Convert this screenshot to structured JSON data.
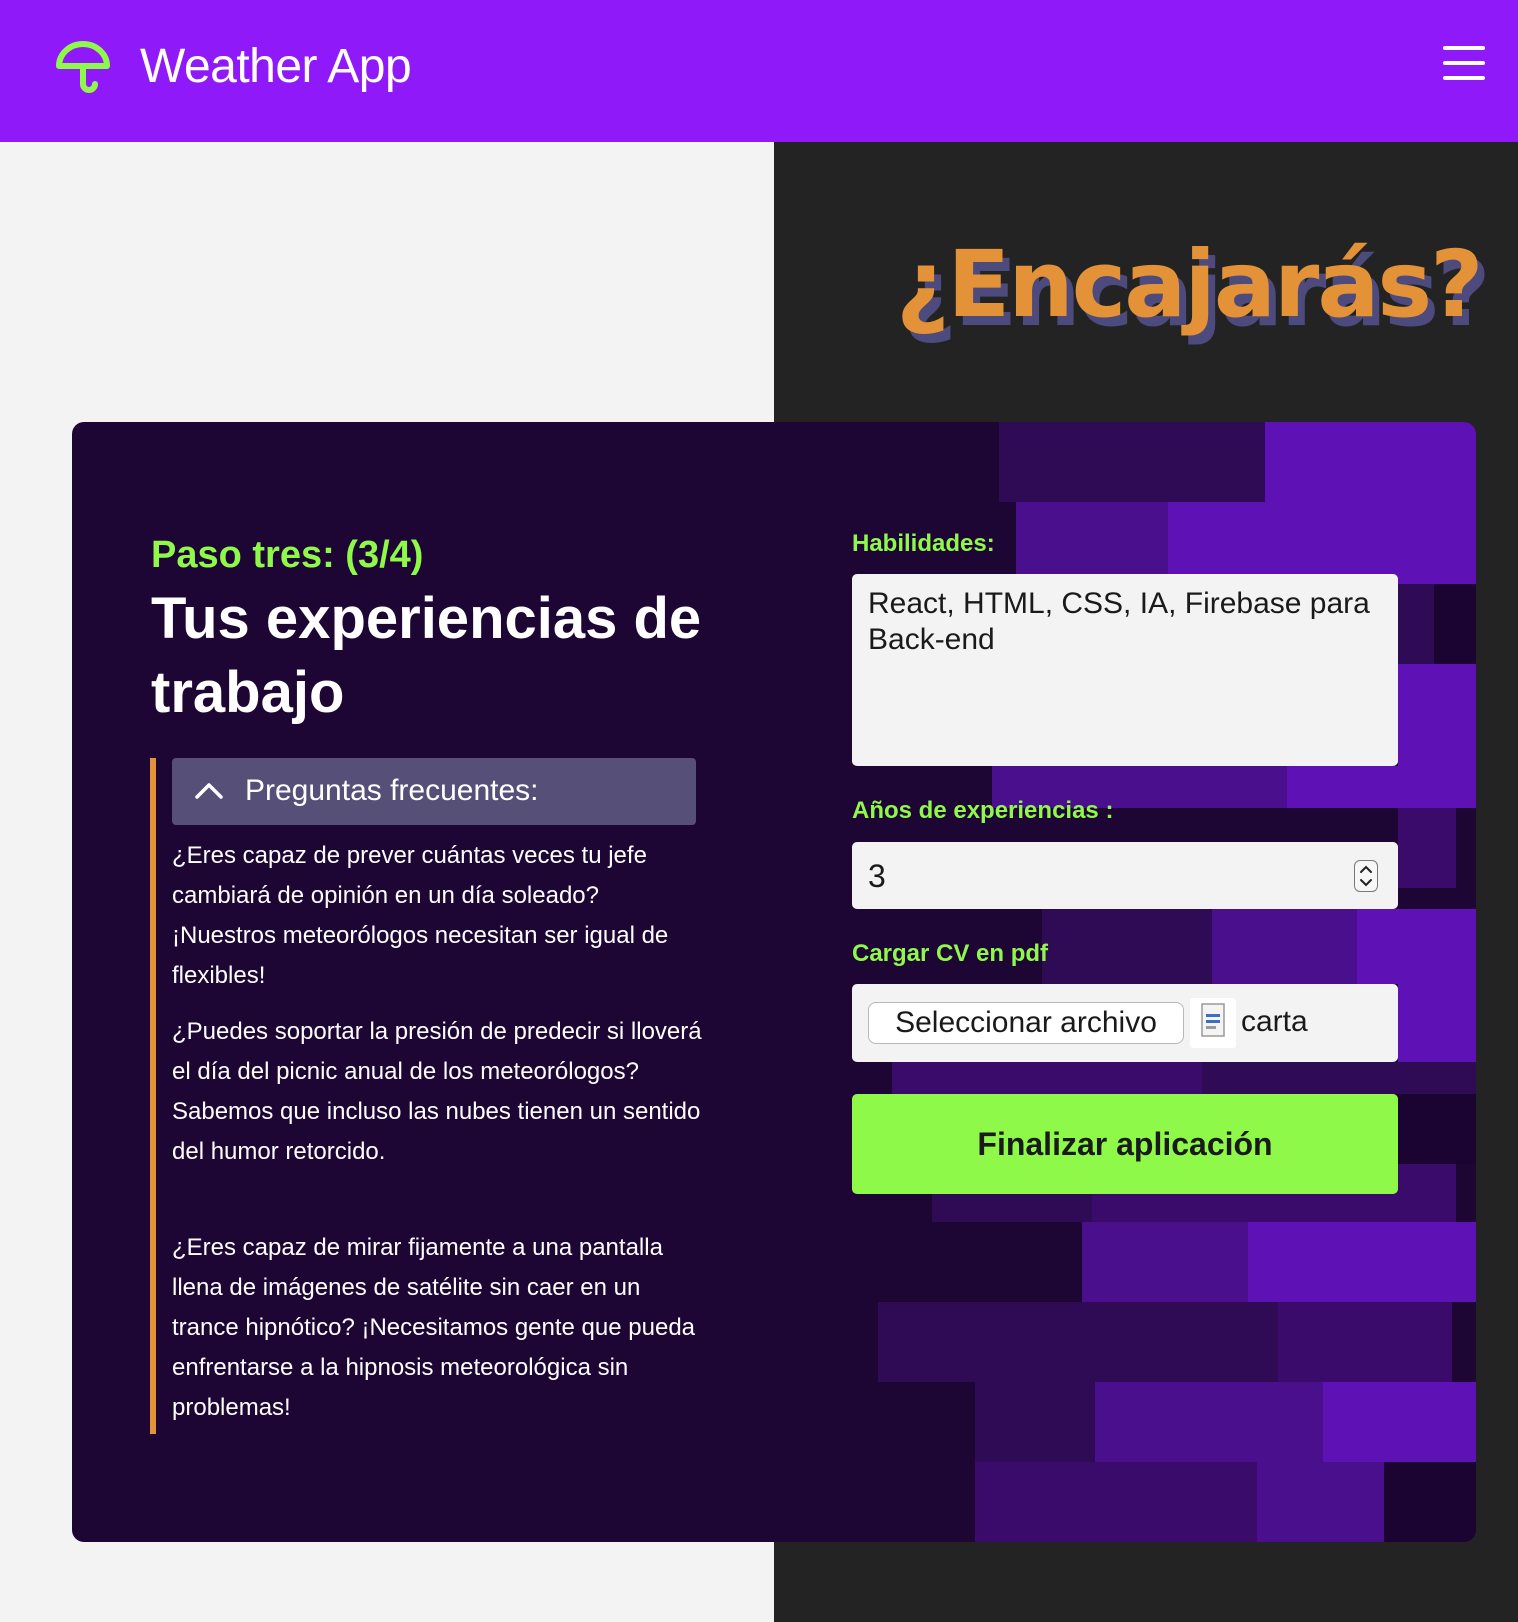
{
  "header": {
    "app_title": "Weather App",
    "logo_icon": "umbrella-icon",
    "menu_icon": "hamburger-menu-icon",
    "brand_color": "#9019f9",
    "logo_color": "#8ff94a"
  },
  "hero": {
    "title": "¿Encajarás?",
    "color": "#e39238",
    "shadow_color": "#4d4a7e"
  },
  "step": {
    "label": "Paso tres: (3/4)",
    "title": "Tus experiencias de trabajo"
  },
  "faq": {
    "title": "Preguntas frecuentes:",
    "toggle_icon": "chevron-up-icon",
    "items": [
      "¿Eres capaz de prever cuántas veces tu jefe cambiará de opinión en un día soleado? ¡Nuestros meteorólogos necesitan ser igual de flexibles!",
      "¿Puedes soportar la presión de predecir si lloverá el día del picnic anual de los meteorólogos? Sabemos que incluso las nubes tienen un sentido del humor retorcido.",
      "¿Eres capaz de mirar fijamente a una pantalla llena de imágenes de satélite sin caer en un trance hipnótico? ¡Necesitamos gente que pueda enfrentarse a la hipnosis meteorológica sin problemas!"
    ]
  },
  "form": {
    "skills_label": "Habilidades:",
    "skills_value": "React, HTML, CSS, IA, Firebase para Back-end",
    "years_label": "Años de experiencias :",
    "years_value": "3",
    "cv_label": "Cargar CV en pdf",
    "file_button": "Seleccionar archivo",
    "file_icon": "pdf-file-icon",
    "file_name": "carta",
    "submit_label": "Finalizar aplicación",
    "accent_color": "#8ff94a"
  }
}
